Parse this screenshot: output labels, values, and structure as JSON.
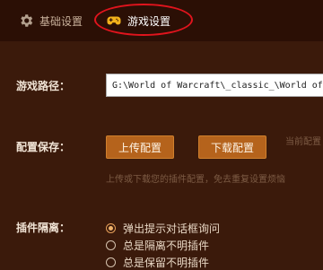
{
  "tabs": {
    "basic": {
      "label": "基础设置",
      "icon": "gear-icon"
    },
    "game": {
      "label": "游戏设置",
      "icon": "gamepad-icon",
      "active": true
    }
  },
  "colors": {
    "background": "#3b1a0b",
    "topbar": "#2b0f05",
    "accent_button": "#b5631c",
    "highlight_ring": "#e0141d"
  },
  "game_path": {
    "label": "游戏路径：",
    "value": "G:\\World of Warcraft\\_classic_\\World of Warcraft"
  },
  "config_save": {
    "label": "配置保存：",
    "upload_label": "上传配置",
    "download_label": "下载配置",
    "current_note": "当前配置",
    "hint": "上传或下载您的插件配置，免去重复设置烦恼"
  },
  "plugin_isolation": {
    "label": "插件隔离：",
    "options": [
      {
        "label": "弹出提示对话框询问",
        "selected": true
      },
      {
        "label": "总是隔离不明插件",
        "selected": false
      },
      {
        "label": "总是保留不明插件",
        "selected": false
      }
    ]
  }
}
